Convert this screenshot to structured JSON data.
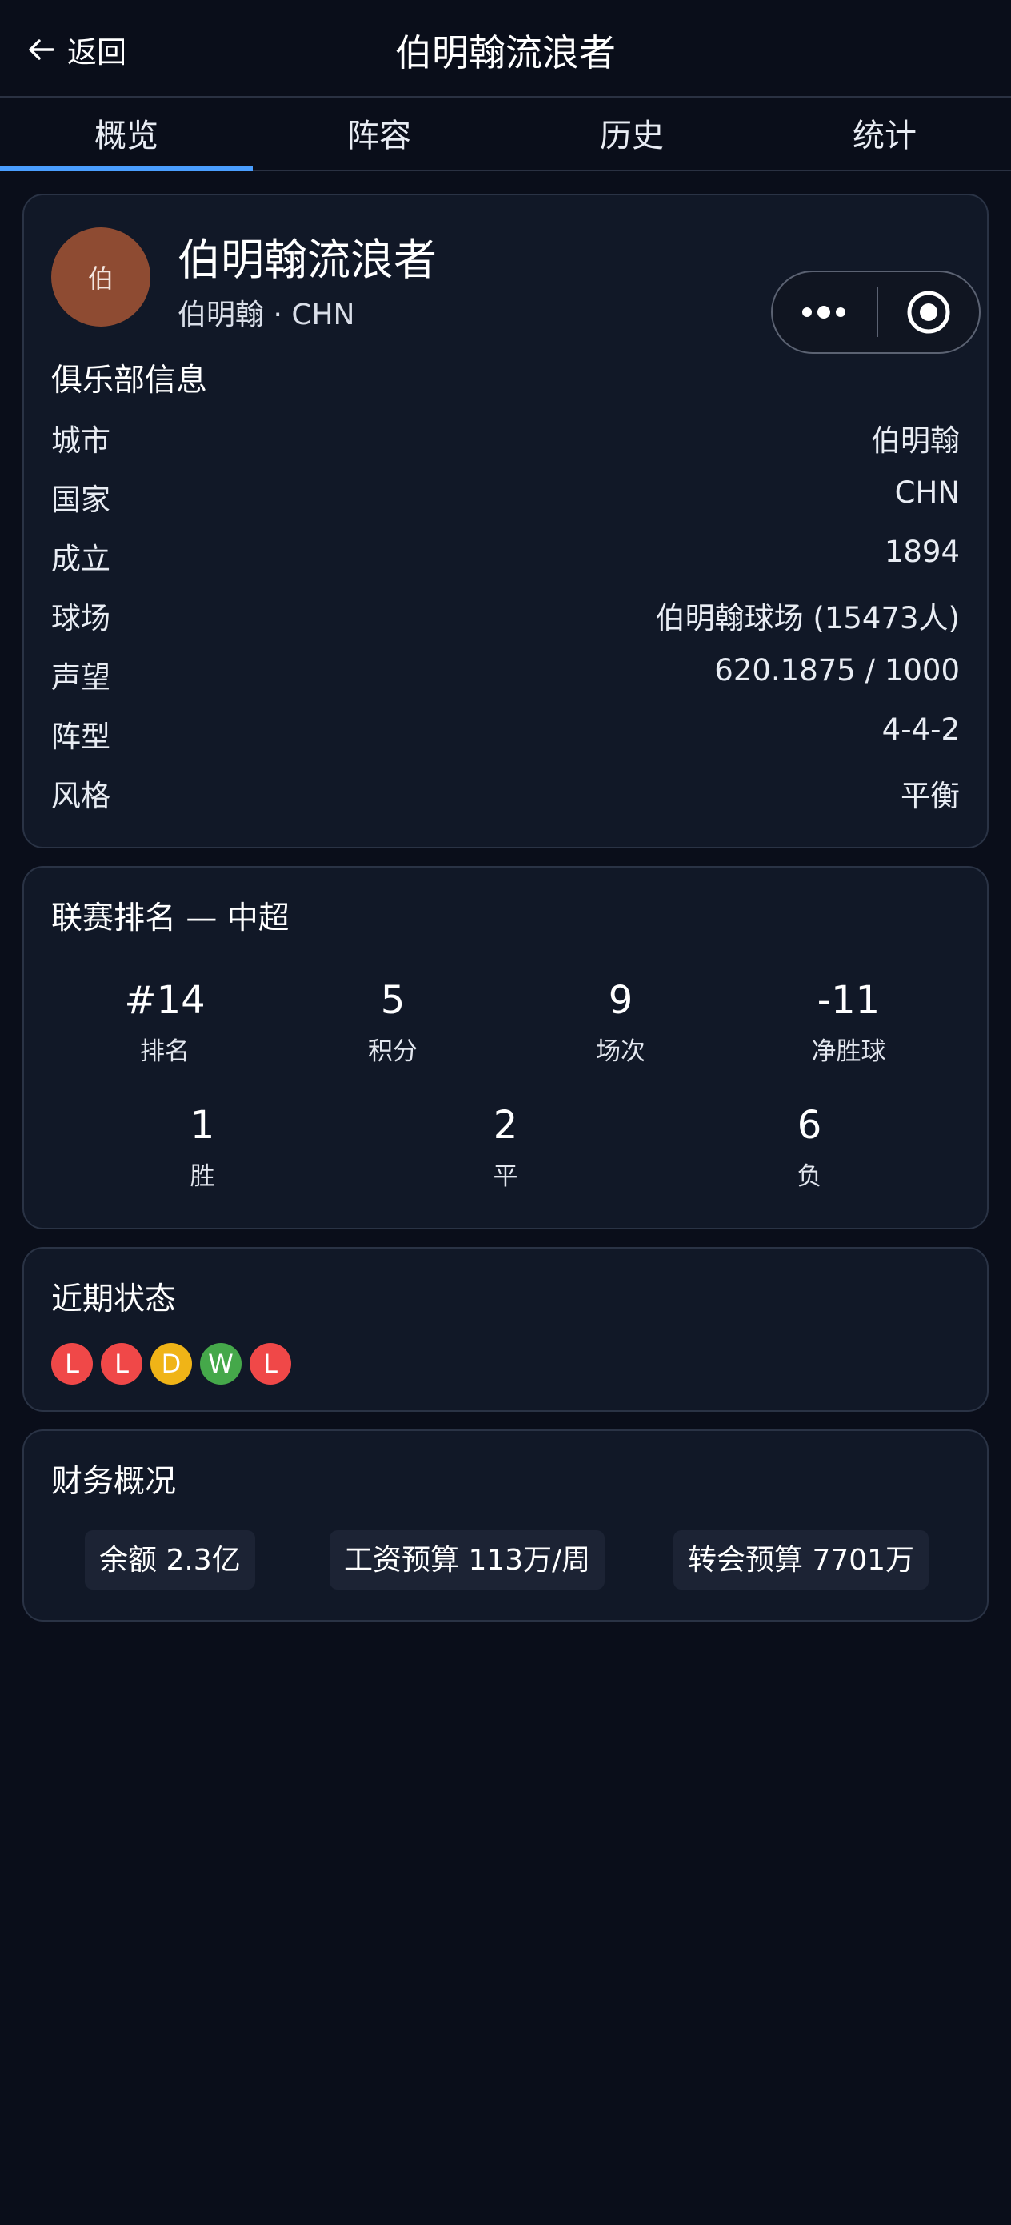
{
  "header": {
    "back_label": "返回",
    "title": "伯明翰流浪者"
  },
  "tabs": [
    {
      "label": "概览",
      "active": true
    },
    {
      "label": "阵容",
      "active": false
    },
    {
      "label": "历史",
      "active": false
    },
    {
      "label": "统计",
      "active": false
    }
  ],
  "club": {
    "avatar_text": "伯",
    "name": "伯明翰流浪者",
    "subtitle": "伯明翰 · CHN",
    "avatar_color": "#8e4b32"
  },
  "club_info": {
    "title": "俱乐部信息",
    "rows": [
      {
        "key": "城市",
        "value": "伯明翰"
      },
      {
        "key": "国家",
        "value": "CHN"
      },
      {
        "key": "成立",
        "value": "1894"
      },
      {
        "key": "球场",
        "value": "伯明翰球场 (15473人)"
      },
      {
        "key": "声望",
        "value": "620.1875 / 1000"
      },
      {
        "key": "阵型",
        "value": "4-4-2"
      },
      {
        "key": "风格",
        "value": "平衡"
      }
    ]
  },
  "standings": {
    "title": "联赛排名 — 中超",
    "top": [
      {
        "value": "#14",
        "label": "排名"
      },
      {
        "value": "5",
        "label": "积分"
      },
      {
        "value": "9",
        "label": "场次"
      },
      {
        "value": "-11",
        "label": "净胜球"
      }
    ],
    "bottom": [
      {
        "value": "1",
        "label": "胜"
      },
      {
        "value": "2",
        "label": "平"
      },
      {
        "value": "6",
        "label": "负"
      }
    ]
  },
  "form": {
    "title": "近期状态",
    "results": [
      {
        "letter": "L",
        "color": "#f04848"
      },
      {
        "letter": "L",
        "color": "#f04848"
      },
      {
        "letter": "D",
        "color": "#f0b417"
      },
      {
        "letter": "W",
        "color": "#45a84a"
      },
      {
        "letter": "L",
        "color": "#f04848"
      }
    ]
  },
  "finance": {
    "title": "财务概况",
    "balance": "余额 2.3亿",
    "wage_budget": "工资预算 113万/周",
    "transfer_budget": "转会预算 7701万"
  },
  "colors": {
    "accent": "#4a9eff",
    "background": "#0a0e1a",
    "card": "#111827"
  }
}
